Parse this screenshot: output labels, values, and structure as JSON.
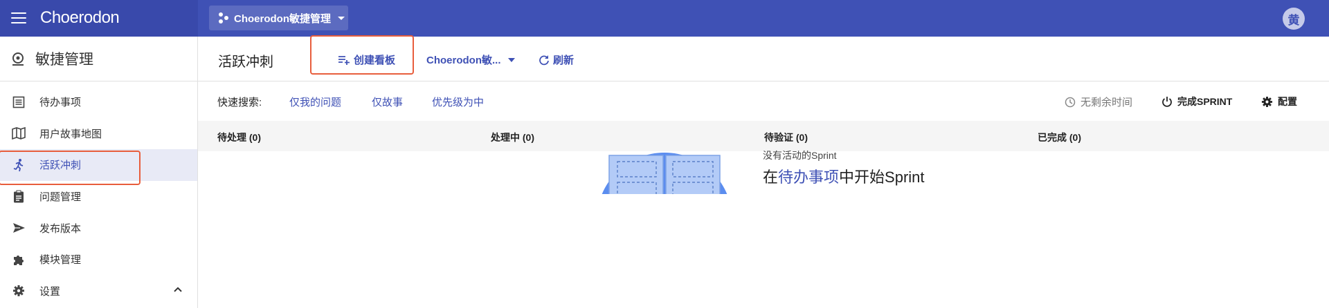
{
  "topbar": {
    "brand": "Choerodon",
    "project": "Choerodon敏捷管理",
    "avatar": "黄"
  },
  "sidebar": {
    "title": "敏捷管理",
    "items": [
      {
        "label": "待办事项",
        "icon": "list-icon"
      },
      {
        "label": "用户故事地图",
        "icon": "map-icon"
      },
      {
        "label": "活跃冲刺",
        "icon": "run-icon",
        "active": true
      },
      {
        "label": "问题管理",
        "icon": "clipboard-icon"
      },
      {
        "label": "发布版本",
        "icon": "send-icon"
      },
      {
        "label": "模块管理",
        "icon": "puzzle-icon"
      },
      {
        "label": "设置",
        "icon": "gear-icon"
      }
    ]
  },
  "page": {
    "title": "活跃冲刺",
    "create_board": "创建看板",
    "board_select": "Choerodon敏...",
    "refresh": "刷新"
  },
  "filters": {
    "label": "快速搜索:",
    "items": [
      "仅我的问题",
      "仅故事",
      "优先级为中"
    ],
    "no_time": "无剩余时间",
    "complete_sprint": "完成SPRINT",
    "config": "配置"
  },
  "columns": [
    "待处理 (0)",
    "处理中 (0)",
    "待验证 (0)",
    "已完成 (0)"
  ],
  "empty": {
    "line1": "没有活动的Sprint",
    "prefix": "在",
    "link": "待办事项",
    "suffix": "中开始Sprint"
  },
  "colors": {
    "primary": "#3f51b5",
    "highlight": "#e85d3c"
  }
}
